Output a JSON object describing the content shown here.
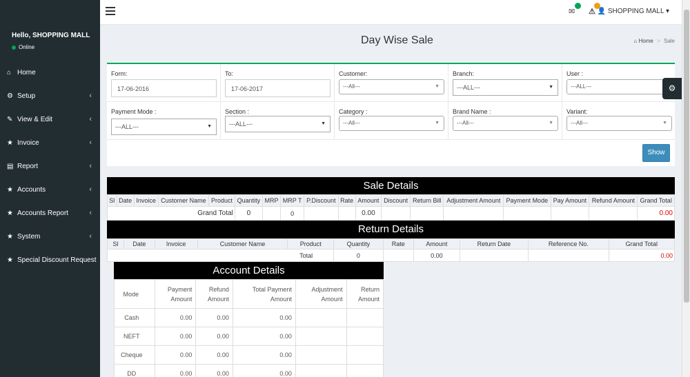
{
  "sidebar": {
    "greeting": "Hello, SHOPPING MALL",
    "status": "Online",
    "items": [
      {
        "label": "Home",
        "icon": "home-icon",
        "glyph": "⌂",
        "chevron": false
      },
      {
        "label": "Setup",
        "icon": "cogs-icon",
        "glyph": "⚙",
        "chevron": true
      },
      {
        "label": "View & Edit",
        "icon": "edit-icon",
        "glyph": "✎",
        "chevron": true
      },
      {
        "label": "Invoice",
        "icon": "star-icon",
        "glyph": "★",
        "chevron": true
      },
      {
        "label": "Report",
        "icon": "file-icon",
        "glyph": "▤",
        "chevron": true
      },
      {
        "label": "Accounts",
        "icon": "star-icon",
        "glyph": "★",
        "chevron": true
      },
      {
        "label": "Accounts Report",
        "icon": "star-icon",
        "glyph": "★",
        "chevron": true
      },
      {
        "label": "System",
        "icon": "star-icon",
        "glyph": "★",
        "chevron": true
      },
      {
        "label": "Special Discount Request",
        "icon": "star-icon",
        "glyph": "★",
        "chevron": false
      }
    ]
  },
  "header": {
    "user": "SHOPPING MALL",
    "badge_colors": {
      "mail": "#00a65a",
      "alert": "#f39c12"
    }
  },
  "page": {
    "title": "Day Wise Sale",
    "breadcrumb_home": "Home",
    "breadcrumb_current": "Sale"
  },
  "filters": {
    "form_label": "Form:",
    "form_value": "17-06-2016",
    "to_label": "To:",
    "to_value": "17-06-2017",
    "customer_label": "Customer:",
    "customer_value": "---All---",
    "branch_label": "Branch:",
    "branch_value": "---ALL---",
    "user_label": "User :",
    "user_value": "---ALL---",
    "payment_label": "Payment Mode :",
    "payment_value": "---ALL---",
    "section_label": "Section :",
    "section_value": "---ALL---",
    "category_label": "Category :",
    "category_value": "---All---",
    "brand_label": "Brand Name :",
    "brand_value": "---All---",
    "variant_label": "Variant:",
    "variant_value": "---All---",
    "show_label": "Show"
  },
  "sale": {
    "title": "Sale Details",
    "columns": [
      "Sl",
      "Date",
      "Invoice",
      "Customer Name",
      "Product",
      "Quantity",
      "MRP",
      "MRP T",
      "P.Discount",
      "Rate",
      "Amount",
      "Discount",
      "Return Bill",
      "Adjustment Amount",
      "Payment Mode",
      "Pay Amount",
      "Refund Amount",
      "Grand Total"
    ],
    "grand_label": "Grand Total",
    "qty": "0",
    "mrpt": "0",
    "amount": "0.00",
    "grand_total": "0.00"
  },
  "returns": {
    "title": "Return Details",
    "columns": [
      "Sl",
      "Date",
      "Invoice",
      "Customer Name",
      "Product",
      "Quantity",
      "Rate",
      "Amount",
      "Return Date",
      "Reference No.",
      "Grand Total"
    ],
    "total_label": "Total",
    "qty": "0",
    "amount": "0.00",
    "grand_total": "0.00"
  },
  "accounts": {
    "title": "Account Details",
    "columns": [
      {
        "l1": "Mode",
        "l2": ""
      },
      {
        "l1": "Payment",
        "l2": "Amount"
      },
      {
        "l1": "Refund",
        "l2": "Amount"
      },
      {
        "l1": "Total Payment",
        "l2": "Amount"
      },
      {
        "l1": "Adjustment",
        "l2": "Amount"
      },
      {
        "l1": "Return",
        "l2": "Amount"
      }
    ],
    "rows": [
      {
        "mode": "Cash",
        "payment": "0.00",
        "refund": "0.00",
        "total": "0.00"
      },
      {
        "mode": "NEFT",
        "payment": "0.00",
        "refund": "0.00",
        "total": "0.00"
      },
      {
        "mode": "Cheque",
        "payment": "0.00",
        "refund": "0.00",
        "total": "0.00"
      },
      {
        "mode": "DD",
        "payment": "0.00",
        "refund": "0.00",
        "total": "0.00"
      }
    ]
  }
}
